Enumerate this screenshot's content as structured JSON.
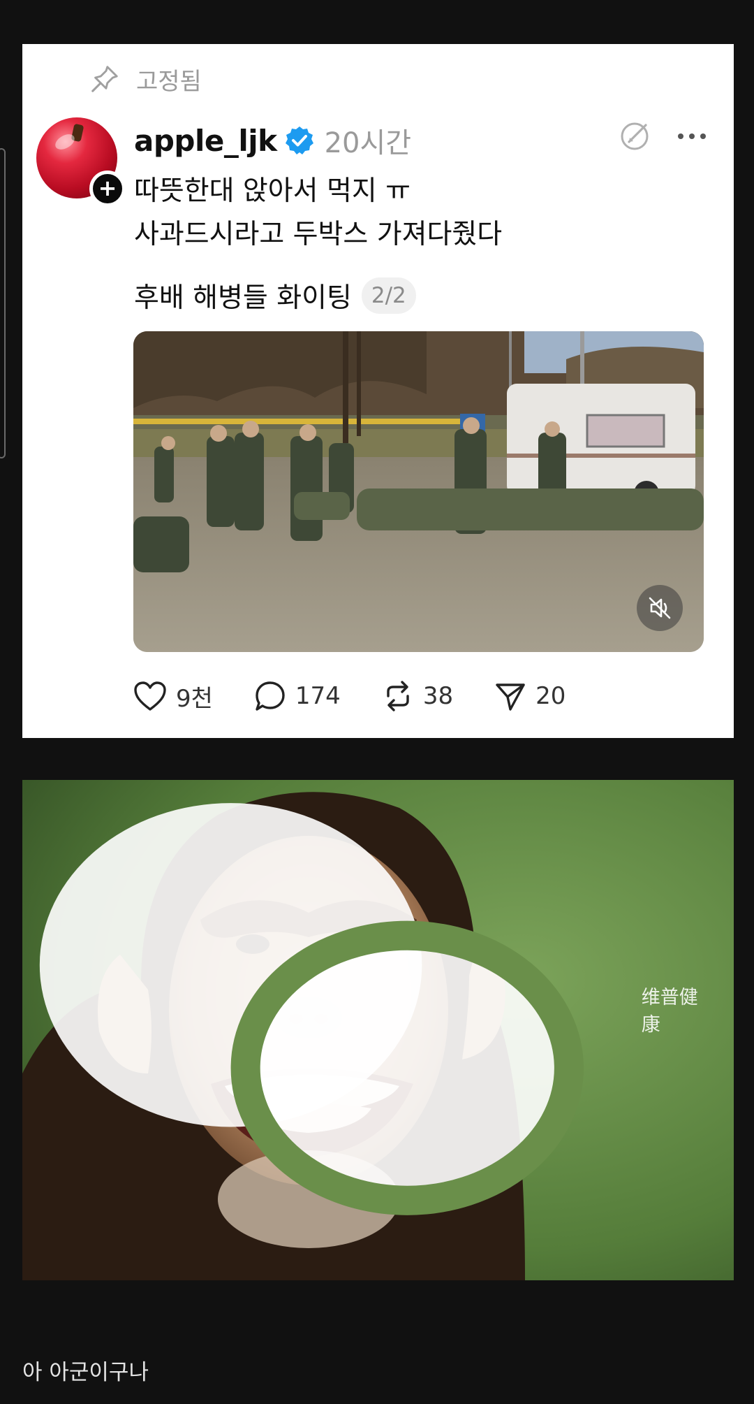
{
  "post": {
    "pinned_label": "고정됨",
    "username": "apple_ljk",
    "time": "20시간",
    "text_lines": [
      "따뜻한대 앉아서 먹지 ㅠ",
      "사과드시라고 두박스 가져다줬다"
    ],
    "subtitle": "후배 해병들 화이팅",
    "page_indicator": "2/2",
    "media": {
      "icon": "muted-speaker-icon"
    },
    "stats": {
      "likes": "9천",
      "comments": "174",
      "reposts": "38",
      "shares": "20"
    }
  },
  "meme": {
    "watermark": "维普健康"
  },
  "caption": "아 아군이구나",
  "colors": {
    "verified": "#1d9bf0",
    "page_background": "#111111",
    "card_background": "#ffffff"
  }
}
